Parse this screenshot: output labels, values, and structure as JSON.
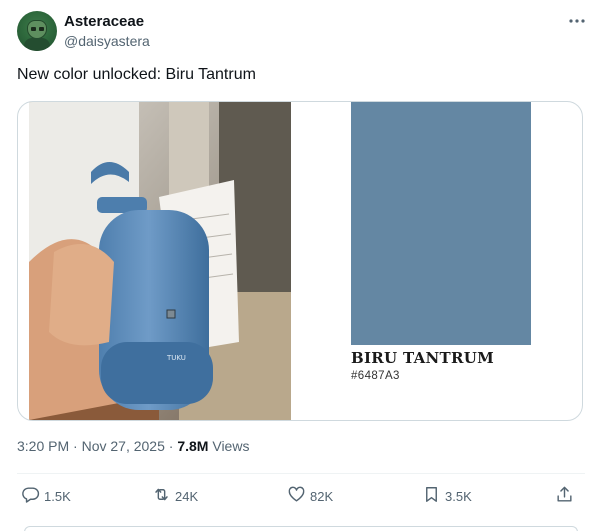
{
  "author": {
    "display_name": "Asteraceae",
    "handle": "@daisyastera",
    "avatar_icon": "avatar-icon"
  },
  "tweet": {
    "text": "New color unlocked: Biru Tantrum"
  },
  "media": {
    "photo_icon": "photo-image",
    "swatch_color": "#6487A3",
    "color_name": "BIRU TANTRUM",
    "color_hex": "#6487A3"
  },
  "meta": {
    "time": "3:20 PM",
    "separator": "·",
    "date": "Nov 27, 2025",
    "views_count": "7.8M",
    "views_label": "Views"
  },
  "actions": {
    "replies": "1.5K",
    "reposts": "24K",
    "likes": "82K",
    "bookmarks": "3.5K"
  },
  "colors": {
    "text_primary": "#0f1419",
    "text_secondary": "#536471",
    "border": "#cfd9de"
  }
}
